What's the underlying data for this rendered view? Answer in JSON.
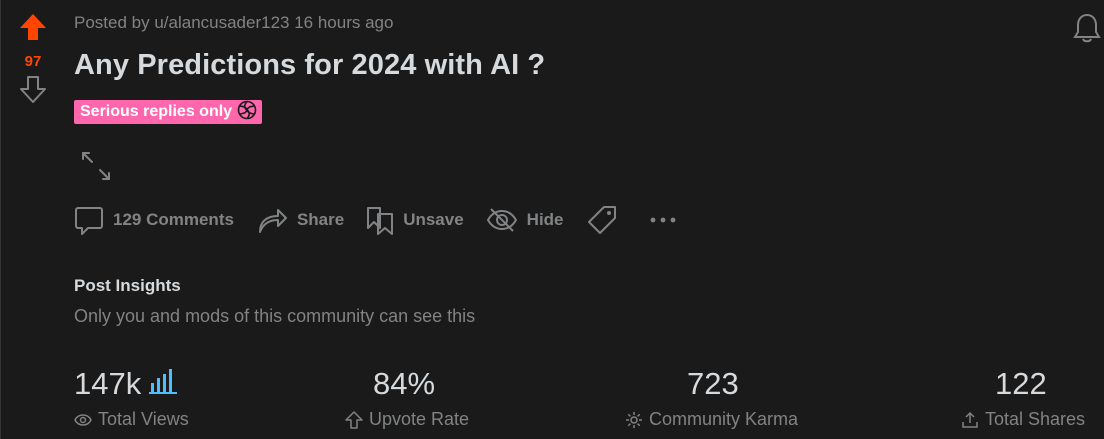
{
  "post": {
    "score": "97",
    "meta": "Posted by u/alancusader123 16 hours ago",
    "title": "Any Predictions for 2024 with AI ?",
    "flair": "Serious replies only"
  },
  "actions": {
    "comments": "129 Comments",
    "share": "Share",
    "unsave": "Unsave",
    "hide": "Hide"
  },
  "insights": {
    "title": "Post Insights",
    "subtitle": "Only you and mods of this community can see this",
    "stats": [
      {
        "value": "147k",
        "label": "Total Views",
        "icon": "eye-icon"
      },
      {
        "value": "84%",
        "label": "Upvote Rate",
        "icon": "upvote-outline-icon"
      },
      {
        "value": "723",
        "label": "Community Karma",
        "icon": "gear-icon"
      },
      {
        "value": "122",
        "label": "Total Shares",
        "icon": "share-upload-icon"
      }
    ]
  },
  "colors": {
    "background": "#1a1a1b",
    "upvote": "#ff4500",
    "flair": "#ff66ac",
    "muted": "#818384",
    "text": "#d7dadc",
    "chart_accent": "#4fbcff"
  }
}
